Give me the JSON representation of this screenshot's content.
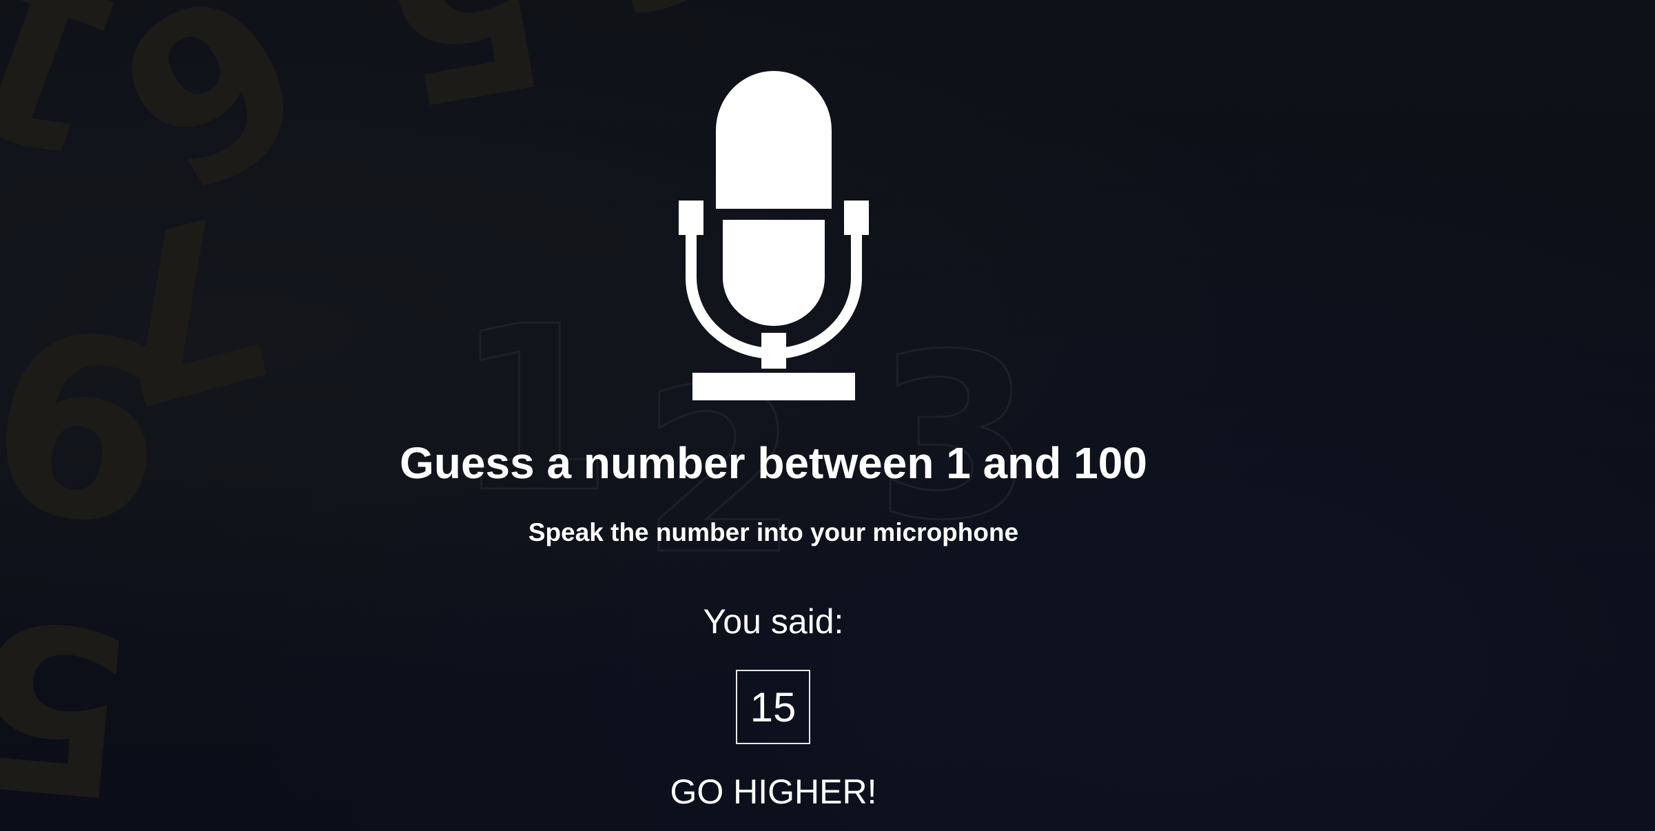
{
  "game": {
    "title": "Guess a number between 1 and 100",
    "subtitle": "Speak the number into your microphone",
    "you_said_label": "You said:",
    "guess_value": "15",
    "hint": "GO HIGHER!"
  },
  "icons": {
    "microphone": "microphone-icon"
  },
  "colors": {
    "background": "#0c0f17",
    "foreground": "#ffffff",
    "background_digits": "#1c1b17"
  }
}
